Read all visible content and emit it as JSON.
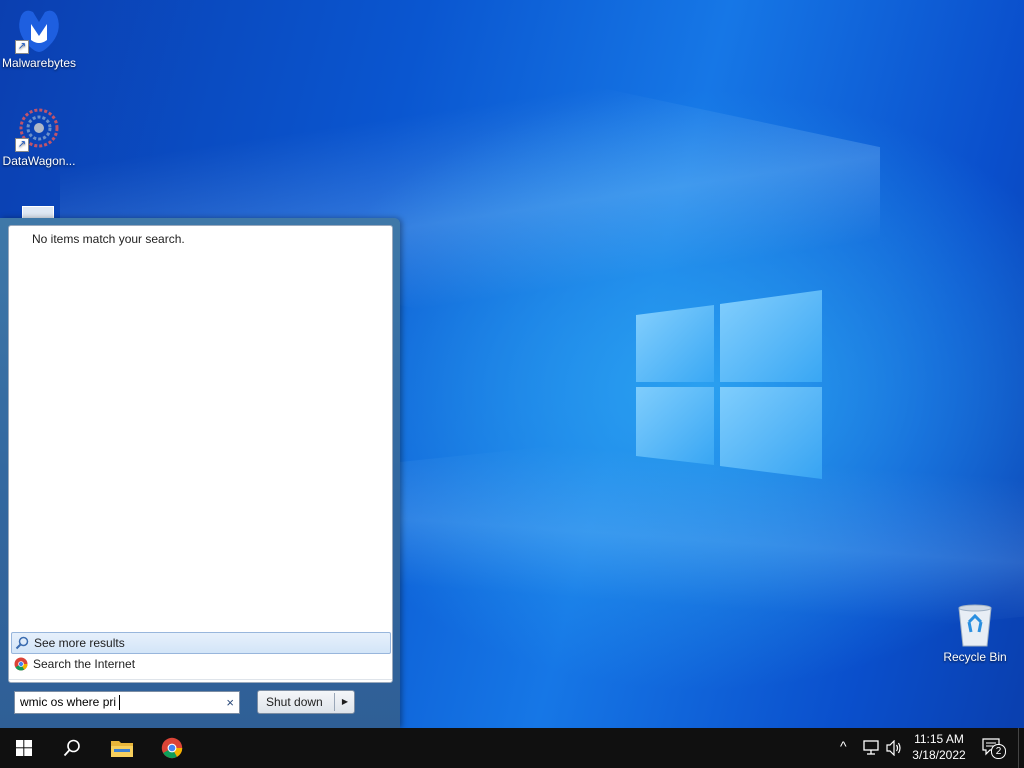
{
  "desktop": {
    "icons": [
      {
        "label": "Malwarebytes",
        "icon": "malwarebytes-icon"
      },
      {
        "label": "DataWagon...",
        "icon": "datawagon-icon"
      },
      {
        "label": "Recycle Bin",
        "icon": "recycle-bin-icon"
      }
    ]
  },
  "start_menu": {
    "no_items_text": "No items match your search.",
    "see_more_label": "See more results",
    "search_internet_label": "Search the Internet",
    "search_value": "wmic os where pri",
    "clear_icon": "×",
    "shutdown_label": "Shut down",
    "shutdown_arrow": "▶"
  },
  "taskbar": {
    "apps": [
      "start-icon",
      "search-icon",
      "file-explorer-icon",
      "chrome-icon"
    ],
    "tray_chevron": "^",
    "time": "11:15 AM",
    "date": "3/18/2022",
    "notification_count": "2"
  },
  "colors": {
    "taskbar": "#101010",
    "start_frame": "#3a70a4",
    "desktop_blue": "#0a56d0"
  }
}
